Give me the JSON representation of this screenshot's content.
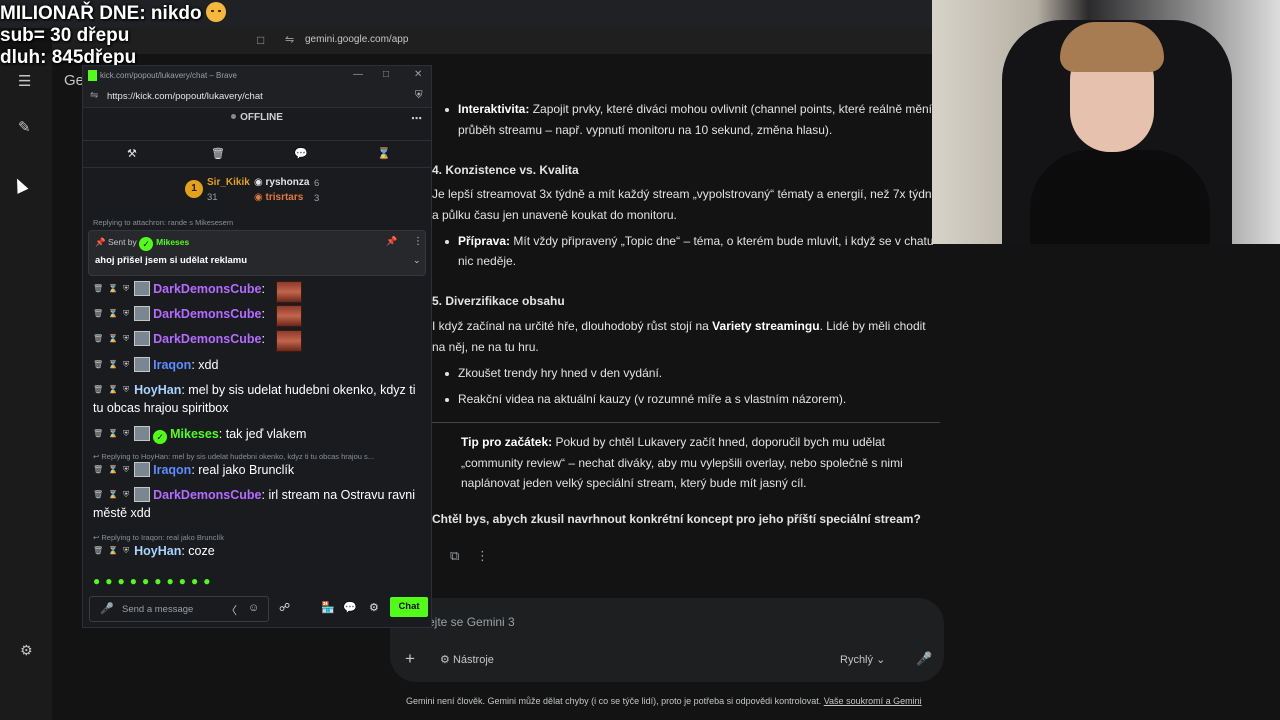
{
  "overlay": {
    "line1": "MILIONAŘ DNE: nikdo",
    "line2": "sub= 30 dřepu",
    "line3": "dluh: 845dřepu"
  },
  "browser": {
    "url": "gemini.google.com/app"
  },
  "gemini": {
    "logo_partial": "Ge",
    "interaktivita_label": "Interaktivita:",
    "interaktivita_text": "Zapojit prvky, které diváci mohou ovlivnit (channel points, které reálně mění",
    "interaktivita_text2": "průběh streamu – např. vypnutí monitoru na 10 sekund, změna hlasu).",
    "h4": "4. Konzistence vs. Kvalita",
    "p4a": "Je lepší streamovat 3x týdně a mít každý stream „vypolstrovaný“ tématy a energií, než 7x týdně",
    "p4b": "a půlku času jen unaveně koukat do monitoru.",
    "priprava_label": "Příprava:",
    "priprava_text": "Mít vždy připravený „Topic dne“ – téma, o kterém bude mluvit, i když se v chatu",
    "priprava_text2": "nic neděje.",
    "h5": "5. Diverzifikace obsahu",
    "p5a_pre": "I když začínal na určité hře, dlouhodobý růst stojí na",
    "p5a_bold": "Variety streamingu",
    "p5a_post": ". Lidé by měli chodit",
    "p5b": "na něj, ne na tu hru.",
    "li1": "Zkoušet trendy hry hned v den vydání.",
    "li2": "Reakční videa na aktuální kauzy (v rozumné míře a s vlastním názorem).",
    "tip_label": "Tip pro začátek:",
    "tip_text": "Pokud by chtěl Lukavery začít hned, doporučil bych mu udělat „community review“ – nechat diváky, aby mu vylepšili overlay, nebo společně s nimi naplánovat jeden velký speciální stream, který bude mít jasný cíl.",
    "question": "Chtěl bys, abych zkusil navrhnout konkrétní koncept pro jeho příští speciální stream?",
    "input_placeholder": "ejte se Gemini 3",
    "tools_label": "Nástroje",
    "mode_label": "Rychlý",
    "footer_text": "Gemini není člověk. Gemini může dělat chyby (i co se týče lidí), proto je potřeba si odpovědi kontrolovat.",
    "footer_link": "Vaše soukromí a Gemini"
  },
  "kick": {
    "window_title": "kick.com/popout/lukavery/chat – Brave",
    "url": "https://kick.com/popout/lukavery/chat",
    "status": "OFFLINE",
    "leaders": {
      "first_rank": "1",
      "first_name": "Sir_Kikik",
      "first_count": "31",
      "second_name": "ryshonza",
      "second_count": "6",
      "third_name": "trisrtars",
      "third_count": "3"
    },
    "reply_top": "Replying to attachron: rande s Mikesesem",
    "pinned": {
      "sent_by_prefix": "Sent by",
      "sent_by_user": "Mikeses",
      "message": "ahoj přišel jsem si udělat reklamu"
    },
    "messages": [
      {
        "user": "DarkDemonsCube",
        "text": ":"
      },
      {
        "user": "DarkDemonsCube",
        "text": ":"
      },
      {
        "user": "DarkDemonsCube",
        "text": ":"
      },
      {
        "user": "Iraqon",
        "text": ": xdd"
      },
      {
        "user": "HoyHan",
        "text": ": mel by sis udelat hudebni okenko, kdyz ti tu obcas hrajou spiritbox"
      },
      {
        "user": "Mikeses",
        "text": ": tak jeď vlakem"
      },
      {
        "user": "Iraqon",
        "text": ": real jako Brunclík"
      },
      {
        "user": "DarkDemonsCube",
        "text": ": irl stream na Ostravu ravni městě xdd"
      },
      {
        "user": "HoyHan",
        "text": ": coze"
      }
    ],
    "reply1": "Replying to HoyHan: mel by sis udelat hudebni okenko, kdyz ti tu obcas hrajou s...",
    "reply2": "Replying to Iraqon: real jako Brunclík",
    "input_placeholder": "Send a message",
    "chat_button": "Chat"
  },
  "colors": {
    "kick_green": "#53fc18",
    "user_purple": "#b46cff",
    "user_blue": "#5c8dff",
    "user_light": "#a9d4ff"
  }
}
